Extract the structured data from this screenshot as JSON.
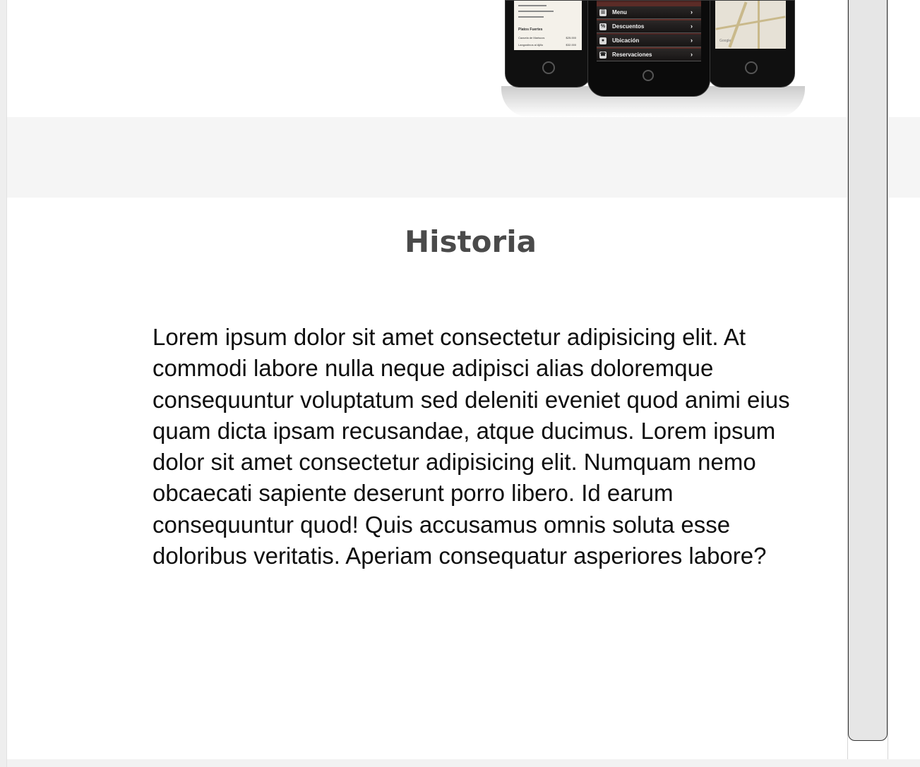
{
  "hero": {
    "app_menu_items": [
      "Menu",
      "Descuentos",
      "Ubicación",
      "Reservaciones"
    ],
    "list_items": [
      {
        "name": "Platos Fuertes",
        "price": ""
      },
      {
        "name": "Cazuela de Mariscos",
        "price": "$25.000"
      },
      {
        "name": "Langostinos al Ajillo",
        "price": "$32.000"
      }
    ],
    "map_label": "Google"
  },
  "section": {
    "title": "Historia",
    "body": "Lorem ipsum dolor sit amet consectetur adipisicing elit. At commodi labore nulla neque adipisci alias doloremque consequuntur voluptatum sed deleniti eveniet quod animi eius quam dicta ipsam recusandae, atque ducimus. Lorem ipsum dolor sit amet consectetur adipisicing elit. Numquam nemo obcaecati sapiente deserunt porro libero. Id earum consequuntur quod! Quis accusamus omnis soluta esse doloribus veritatis. Aperiam consequatur asperiores labore?"
  },
  "colors": {
    "heading": "#4a4a4a",
    "text": "#0e0e0e",
    "band": "#f5f5f5",
    "scroll_thumb": "#e6e6e6"
  }
}
